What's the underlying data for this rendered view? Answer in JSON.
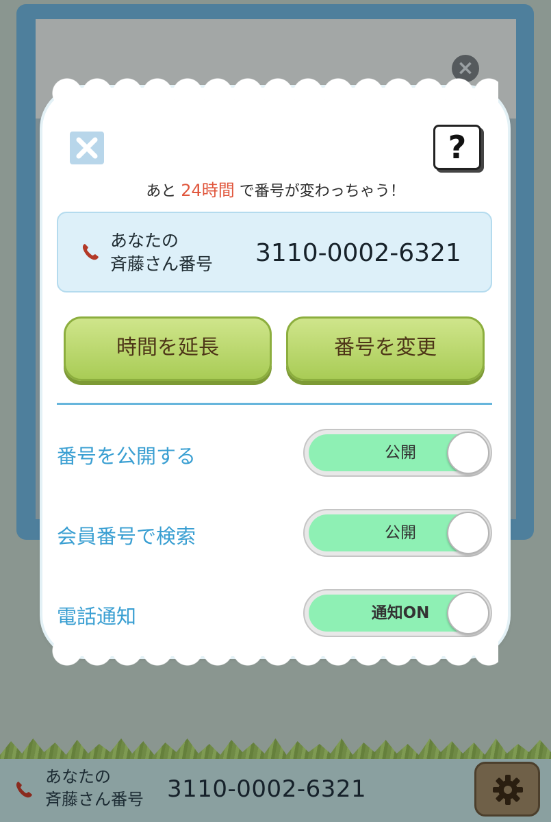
{
  "background": {
    "footer": {
      "label_line1": "あなたの",
      "label_line2": "斉藤さん番号",
      "number": "3110-0002-6321"
    }
  },
  "modal": {
    "timer": {
      "prefix": "あと",
      "highlight": "24時間",
      "suffix": "で番号が変わっちゃう！"
    },
    "help_label": "?",
    "card": {
      "label_line1": "あなたの",
      "label_line2": "斉藤さん番号",
      "number": "3110-0002-6321"
    },
    "buttons": {
      "extend": "時間を延長",
      "change": "番号を変更"
    },
    "settings": [
      {
        "label": "番号を公開する",
        "toggle_text": "公開"
      },
      {
        "label": "会員番号で検索",
        "toggle_text": "公開"
      },
      {
        "label": "電話通知",
        "toggle_text": "通知ON"
      }
    ]
  },
  "colors": {
    "accent": "#3a9fd2",
    "highlight": "#e0563c",
    "toggle_on": "#8ef0b4",
    "button_green": "#a9cc56"
  }
}
